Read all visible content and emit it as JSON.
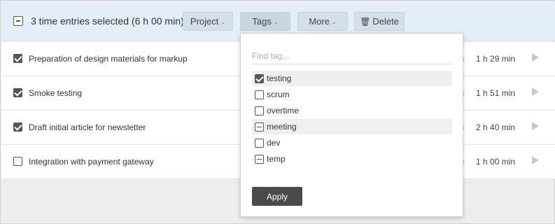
{
  "bulk_bar": {
    "selection_text": "3 time entries selected (6 h 00 min)",
    "buttons": {
      "project": "Project",
      "tags": "Tags",
      "more": "More",
      "delete": "Delete"
    }
  },
  "entries": [
    {
      "description": "Preparation of design materials for markup",
      "duration": "1 h 29 min",
      "checked": true
    },
    {
      "description": "Smoke testing",
      "duration": "1 h 51 min",
      "checked": true
    },
    {
      "description": "Draft initial article for newsletter",
      "duration": "2 h 40 min",
      "checked": true
    },
    {
      "description": "Integration with payment gateway",
      "duration": "1 h 00 min",
      "checked": false
    }
  ],
  "tags_dropdown": {
    "search_placeholder": "Find tag...",
    "search_value": "",
    "tags": [
      {
        "label": "testing",
        "state": "checked"
      },
      {
        "label": "scrum",
        "state": "unchecked"
      },
      {
        "label": "overtime",
        "state": "unchecked"
      },
      {
        "label": "meeting",
        "state": "partial"
      },
      {
        "label": "dev",
        "state": "unchecked"
      },
      {
        "label": "temp",
        "state": "partial"
      }
    ],
    "apply_label": "Apply"
  },
  "colors": {
    "header_bg": "#e3eef8",
    "button_bg": "#d4dfe9",
    "apply_bg": "#4a4a4a",
    "page_bg": "#ededed"
  },
  "icons": {
    "delete": "trash-icon",
    "play": "play-icon",
    "dropdown": "chevron-down-icon"
  }
}
